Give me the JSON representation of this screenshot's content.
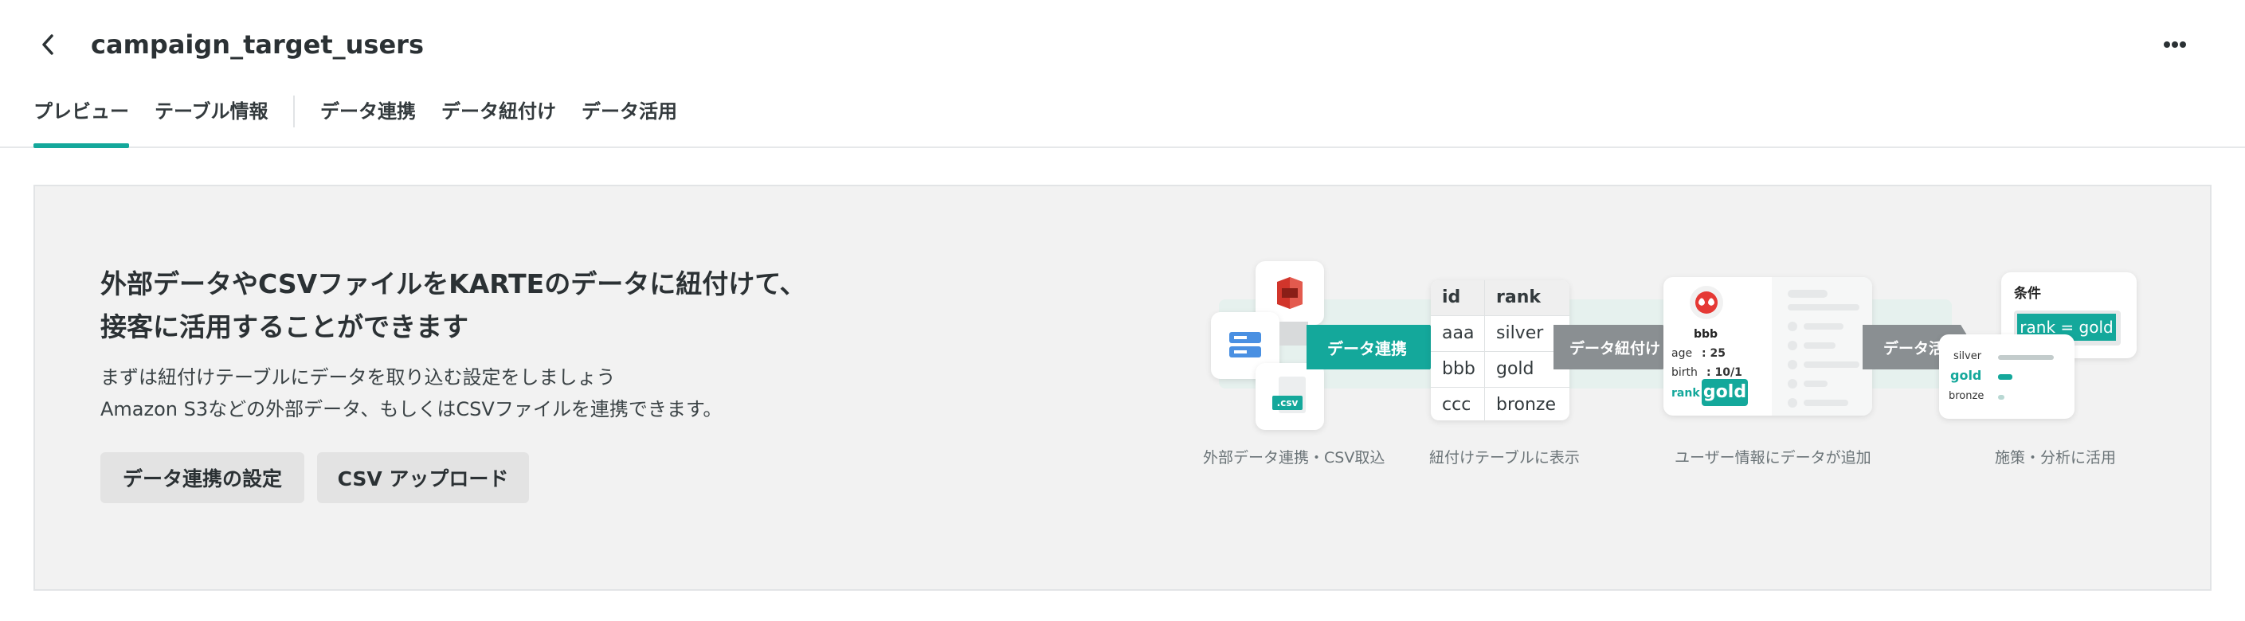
{
  "header": {
    "title": "campaign_target_users",
    "back_icon": "chevron-left-icon",
    "more_icon": "more-horizontal-icon"
  },
  "tabs": [
    {
      "label": "プレビュー",
      "active": true
    },
    {
      "label": "テーブル情報",
      "active": false
    },
    {
      "label": "データ連携",
      "active": false
    },
    {
      "label": "データ紐付け",
      "active": false
    },
    {
      "label": "データ活用",
      "active": false
    }
  ],
  "hero": {
    "title_line1": "外部データやCSVファイルをKARTEのデータに紐付けて、",
    "title_line2": "接客に活用することができます",
    "desc_line1": "まずは紐付けテーブルにデータを取り込む設定をしましょう",
    "desc_line2": "Amazon S3などの外部データ、もしくはCSVファイルを連携できます。",
    "btn_integration": "データ連携の設定",
    "btn_csv": "CSV アップロード"
  },
  "illustration": {
    "captions": [
      "外部データ連携・CSV取込",
      "紐付けテーブルに表示",
      "ユーザー情報にデータが追加",
      "施策・分析に活用"
    ],
    "arrows": [
      "データ連携",
      "データ紐付け",
      "データ活用"
    ],
    "csv_label": ".csv",
    "table": {
      "headers": [
        "id",
        "rank"
      ],
      "rows": [
        [
          "aaa",
          "silver"
        ],
        [
          "bbb",
          "gold"
        ],
        [
          "ccc",
          "bronze"
        ]
      ]
    },
    "user": {
      "name": "bbb",
      "age_label": "age",
      "age_value": ": 25",
      "birth_label": "birth",
      "birth_value": ": 10/1",
      "rank_label": "rank",
      "rank_value": "gold"
    },
    "condition": {
      "title": "条件",
      "value": "rank = gold"
    },
    "ranking": [
      "silver",
      "gold",
      "bronze"
    ],
    "colors": {
      "accent": "#14a89b",
      "arrow_gray": "#8a8f92"
    }
  }
}
